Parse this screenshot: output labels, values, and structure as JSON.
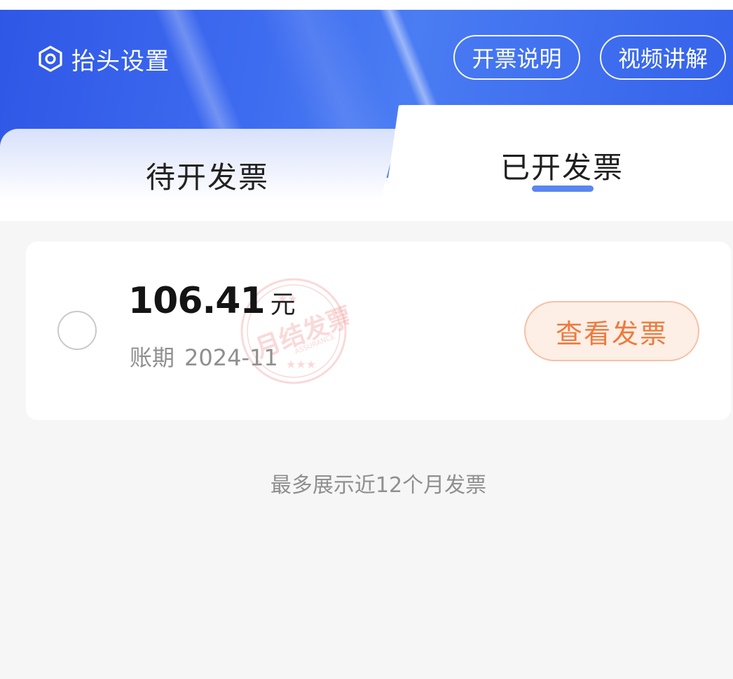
{
  "header": {
    "settings_label": "抬头设置",
    "settings_icon": "hexagon-gear-icon",
    "buttons": [
      {
        "label": "开票说明"
      },
      {
        "label": "视频讲解"
      }
    ],
    "banner_color": "#3461ea"
  },
  "tabs": [
    {
      "label": "待开发票",
      "active": false
    },
    {
      "label": "已开发票",
      "active": true
    }
  ],
  "invoice": {
    "amount": "106.41",
    "unit": "元",
    "period_label": "账期",
    "period_value": "2024-11",
    "stamp_text": "月结发票",
    "stamp_small_text": "ASSURANCE",
    "stamp_color": "#f08a8a",
    "view_button_label": "查看发票",
    "selected": false
  },
  "footer_note": "最多展示近12个月发票",
  "colors": {
    "accent": "#5a86f2",
    "action_orange": "#ee7a3c"
  }
}
